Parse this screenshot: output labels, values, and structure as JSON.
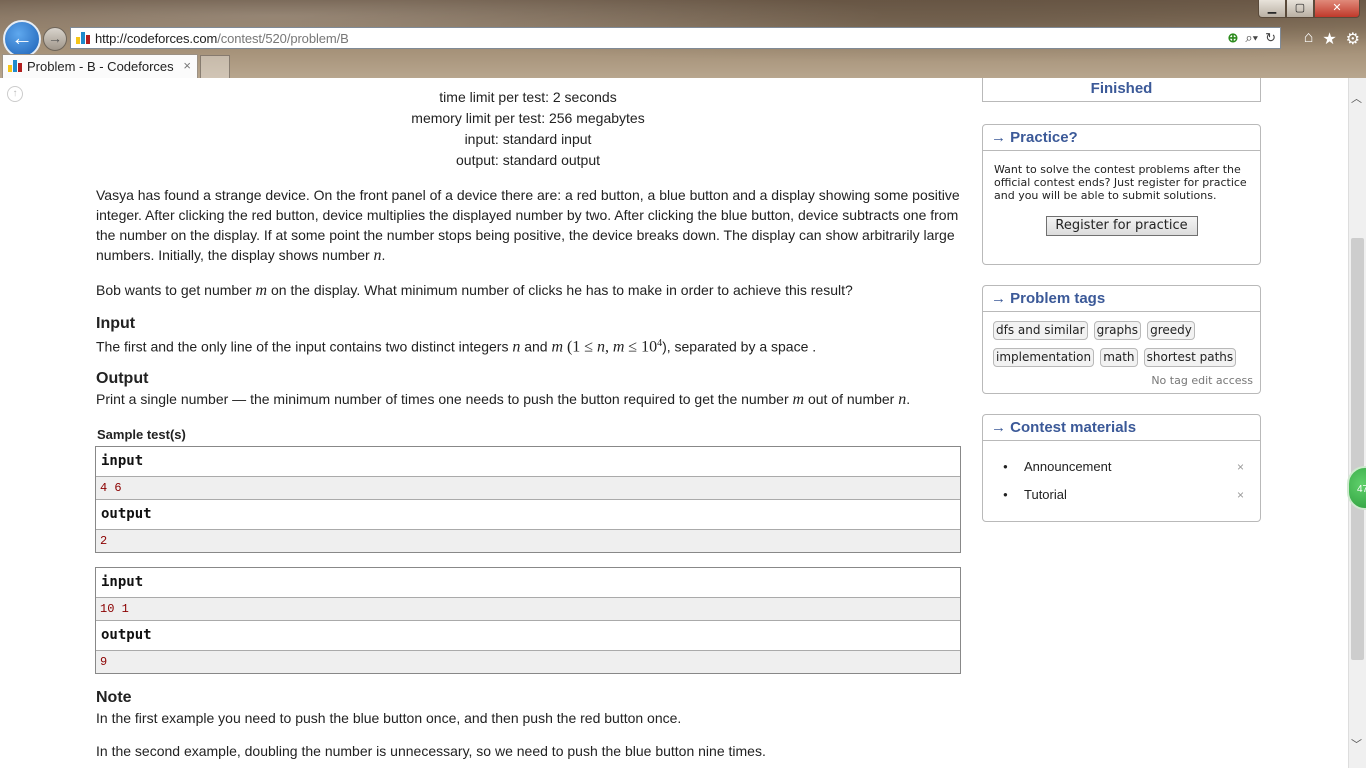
{
  "browser": {
    "url_host": "http://codeforces.com",
    "url_path": "/contest/520/problem/B",
    "tab_title": "Problem - B - Codeforces",
    "tab_close": "×",
    "window_min": "▁",
    "window_max": "▢",
    "window_close": "✕"
  },
  "problem": {
    "time_limit": "time limit per test: 2 seconds",
    "memory_limit": "memory limit per test: 256 megabytes",
    "input_file": "input: standard input",
    "output_file": "output: standard output",
    "legend_1": "Vasya has found a strange device. On the front panel of a device there are: a red button, a blue button and a display showing some positive integer. After clicking the red button, device multiplies the displayed number by two. After clicking the blue button, device subtracts one from the number on the display. If at some point the number stops being positive, the device breaks down. The display can show arbitrarily large numbers. Initially, the display shows number",
    "legend_1_var": "n",
    "legend_2_pre": "Bob wants to get number",
    "legend_2_var": "m",
    "legend_2_post": "on the display. What minimum number of clicks he has to make in order to achieve this result?",
    "input_title": "Input",
    "input_pre": "The first and the only line of the input contains two distinct integers",
    "input_n": "n",
    "input_and": "and",
    "input_m": "m",
    "input_constraint_pre": "(1 ≤",
    "input_constraint_n": "n",
    "input_constraint_mid": ",",
    "input_constraint_m": "m",
    "input_constraint_post": "≤ 10",
    "input_constraint_exp": "4",
    "input_post": "), separated by a space .",
    "output_title": "Output",
    "output_pre": "Print a single number — the minimum number of times one needs to push the button required to get the number",
    "output_m": "m",
    "output_mid": "out of number",
    "output_n": "n",
    "sample_title": "Sample test(s)",
    "samples": [
      {
        "input_label": "input",
        "input": "4 6",
        "output_label": "output",
        "output": "2"
      },
      {
        "input_label": "input",
        "input": "10 1",
        "output_label": "output",
        "output": "9"
      }
    ],
    "note_title": "Note",
    "note_1": "In the first example you need to push the blue button once, and then push the red button once.",
    "note_2": "In the second example, doubling the number is unnecessary, so we need to push the blue button nine times."
  },
  "sidebar": {
    "status": "Finished",
    "practice_title": "→ Practice?",
    "practice_text": "Want to solve the contest problems after the official contest ends? Just register for practice and you will be able to submit solutions.",
    "practice_button": "Register for practice",
    "tags_title": "→ Problem tags",
    "tags": [
      "dfs and similar",
      "graphs",
      "greedy",
      "implementation",
      "math",
      "shortest paths"
    ],
    "no_tag_edit": "No tag edit access",
    "materials_title": "→ Contest materials",
    "materials": [
      "Announcement",
      "Tutorial"
    ],
    "material_remove": "×"
  },
  "badge": "47"
}
